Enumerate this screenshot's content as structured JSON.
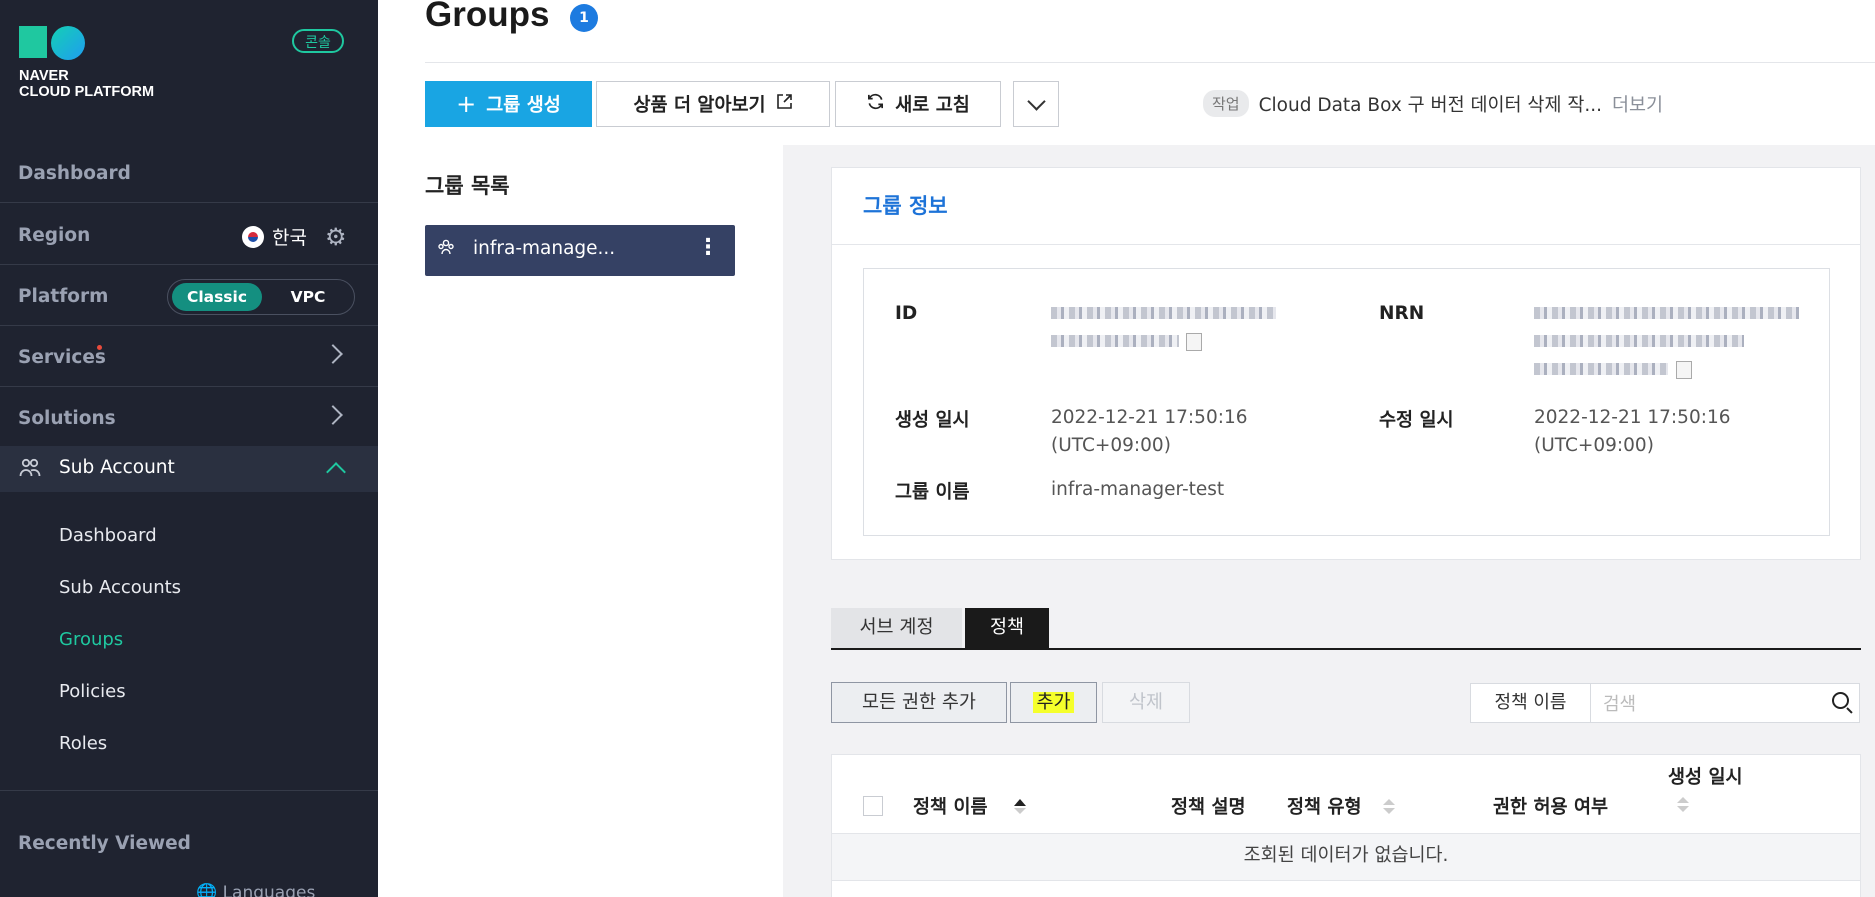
{
  "sidebar": {
    "brand_line1": "NAVER",
    "brand_line2": "CLOUD PLATFORM",
    "console_badge": "콘솔",
    "dashboard": "Dashboard",
    "region_label": "Region",
    "region_value": "한국",
    "platform_label": "Platform",
    "platform_classic": "Classic",
    "platform_vpc": "VPC",
    "services": "Services",
    "solutions": "Solutions",
    "sub_account": "Sub Account",
    "sub_items": [
      "Dashboard",
      "Sub Accounts",
      "Groups",
      "Policies",
      "Roles"
    ],
    "active_sub_item": "Groups",
    "recently_viewed": "Recently Viewed",
    "languages": "Languages"
  },
  "header": {
    "title": "Groups",
    "count": "1",
    "create_button": "그룹 생성",
    "learn_more_button": "상품 더 알아보기",
    "refresh_button": "새로 고침",
    "notice_tag": "작업",
    "notice_text": "Cloud Data Box 구 버전 데이터 삭제 작...",
    "notice_more": "더보기"
  },
  "group_list": {
    "title": "그룹 목록",
    "items": [
      {
        "name": "infra-manage..."
      }
    ]
  },
  "group_info": {
    "title": "그룹 정보",
    "id_label": "ID",
    "nrn_label": "NRN",
    "created_label": "생성 일시",
    "created_value": "2022-12-21 17:50:16",
    "created_tz": "(UTC+09:00)",
    "modified_label": "수정 일시",
    "modified_value": "2022-12-21 17:50:16",
    "modified_tz": "(UTC+09:00)",
    "name_label": "그룹 이름",
    "name_value": "infra-manager-test"
  },
  "tabs": [
    {
      "label": "서브 계정",
      "active": false
    },
    {
      "label": "정책",
      "active": true
    }
  ],
  "actions": {
    "add_all": "모든 권한 추가",
    "add": "추가",
    "delete": "삭제",
    "search_label": "정책 이름",
    "search_placeholder": "검색"
  },
  "table": {
    "columns": [
      "정책 이름",
      "정책 설명",
      "정책 유형",
      "권한 허용 여부",
      "생성 일시"
    ],
    "empty_message": "조회된 데이터가 없습니다."
  },
  "colors": {
    "sidebar_bg": "#1f2330",
    "accent_teal": "#1fc8a0",
    "primary_blue": "#19a5e3",
    "active_group": "#354164",
    "info_title_blue": "#1d73d8",
    "highlight_yellow": "#f5ff2b"
  }
}
